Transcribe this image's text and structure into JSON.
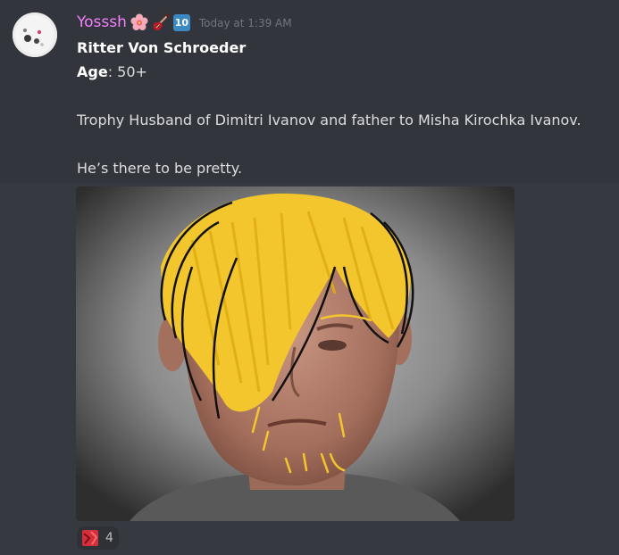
{
  "message": {
    "username": "Yosssh",
    "badges": [
      "cherry-blossom-icon",
      "guitar-icon",
      "keycap-ten-icon"
    ],
    "badge_ten_label": "10",
    "timestamp": "Today at 1:39 AM",
    "title": "Ritter Von Schroeder",
    "age_label": "Age",
    "age_value": ": 50+",
    "description": "Trophy Husband of Dimitri Ivanov and father to Misha Kirochka Ivanov.",
    "note": "He’s there to be pretty."
  },
  "attachment": {
    "kind": "image",
    "subject": "man-portrait-with-yellow-hair-doodle"
  },
  "reaction": {
    "emoji": "custom-red-emoji",
    "count": "4"
  },
  "colors": {
    "background": "#36393f",
    "message_hover": "#32353b",
    "username": "#f47fff",
    "text": "#dcddde",
    "timestamp": "#72767d"
  }
}
